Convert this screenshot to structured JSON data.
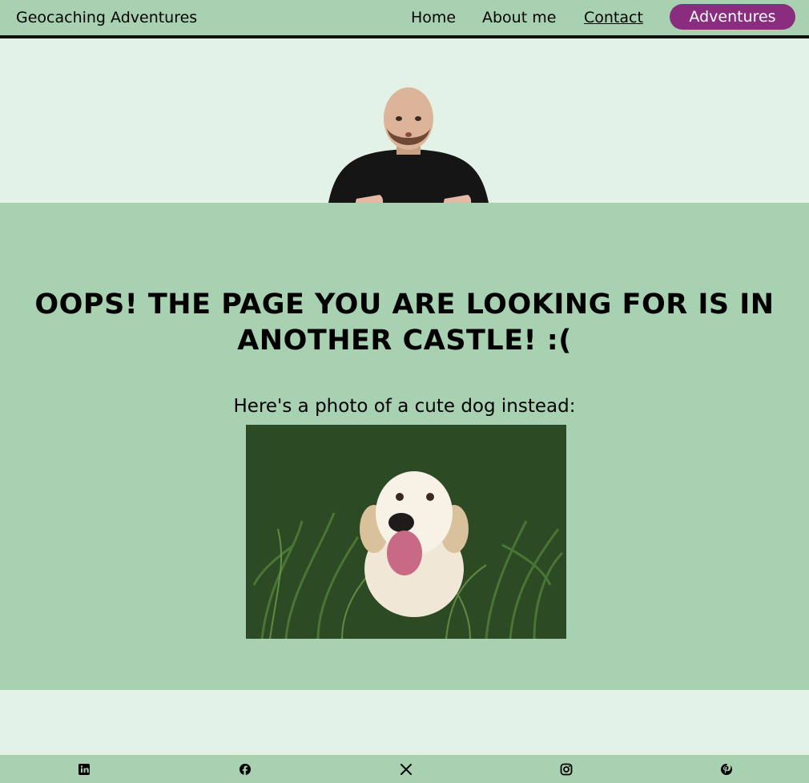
{
  "site": {
    "brand": "Geocaching Adventures"
  },
  "nav": {
    "items": [
      {
        "label": "Home"
      },
      {
        "label": "About me"
      },
      {
        "label": "Contact"
      }
    ],
    "cta_label": "Adventures"
  },
  "error": {
    "heading": "OOPS! THE PAGE YOU ARE LOOKING FOR IS IN ANOTHER CASTLE! :(",
    "subtitle": "Here's a photo of a cute dog instead:"
  },
  "images": {
    "person": "bald-man-peeking-icon",
    "dog": "golden-retriever-in-grass-icon"
  },
  "footer": {
    "social_icons": [
      "linkedin-icon",
      "facebook-icon",
      "x-icon",
      "instagram-icon",
      "pinterest-icon"
    ]
  },
  "colors": {
    "header_bg": "#a8d1b1",
    "page_bg": "#e2f2e6",
    "cta_bg": "#8b2d7f"
  }
}
